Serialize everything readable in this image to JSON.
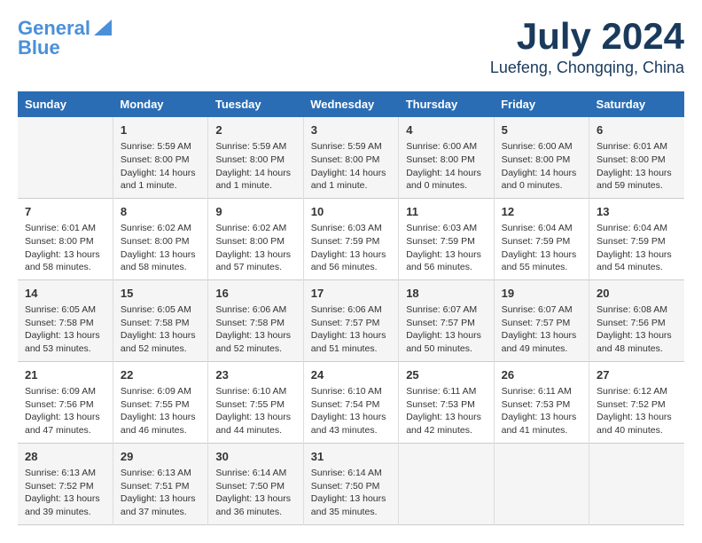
{
  "header": {
    "logo_line1": "General",
    "logo_line2": "Blue",
    "month_year": "July 2024",
    "location": "Luefeng, Chongqing, China"
  },
  "days_of_week": [
    "Sunday",
    "Monday",
    "Tuesday",
    "Wednesday",
    "Thursday",
    "Friday",
    "Saturday"
  ],
  "weeks": [
    [
      {
        "day": "",
        "content": ""
      },
      {
        "day": "1",
        "content": "Sunrise: 5:59 AM\nSunset: 8:00 PM\nDaylight: 14 hours\nand 1 minute."
      },
      {
        "day": "2",
        "content": "Sunrise: 5:59 AM\nSunset: 8:00 PM\nDaylight: 14 hours\nand 1 minute."
      },
      {
        "day": "3",
        "content": "Sunrise: 5:59 AM\nSunset: 8:00 PM\nDaylight: 14 hours\nand 1 minute."
      },
      {
        "day": "4",
        "content": "Sunrise: 6:00 AM\nSunset: 8:00 PM\nDaylight: 14 hours\nand 0 minutes."
      },
      {
        "day": "5",
        "content": "Sunrise: 6:00 AM\nSunset: 8:00 PM\nDaylight: 14 hours\nand 0 minutes."
      },
      {
        "day": "6",
        "content": "Sunrise: 6:01 AM\nSunset: 8:00 PM\nDaylight: 13 hours\nand 59 minutes."
      }
    ],
    [
      {
        "day": "7",
        "content": "Sunrise: 6:01 AM\nSunset: 8:00 PM\nDaylight: 13 hours\nand 58 minutes."
      },
      {
        "day": "8",
        "content": "Sunrise: 6:02 AM\nSunset: 8:00 PM\nDaylight: 13 hours\nand 58 minutes."
      },
      {
        "day": "9",
        "content": "Sunrise: 6:02 AM\nSunset: 8:00 PM\nDaylight: 13 hours\nand 57 minutes."
      },
      {
        "day": "10",
        "content": "Sunrise: 6:03 AM\nSunset: 7:59 PM\nDaylight: 13 hours\nand 56 minutes."
      },
      {
        "day": "11",
        "content": "Sunrise: 6:03 AM\nSunset: 7:59 PM\nDaylight: 13 hours\nand 56 minutes."
      },
      {
        "day": "12",
        "content": "Sunrise: 6:04 AM\nSunset: 7:59 PM\nDaylight: 13 hours\nand 55 minutes."
      },
      {
        "day": "13",
        "content": "Sunrise: 6:04 AM\nSunset: 7:59 PM\nDaylight: 13 hours\nand 54 minutes."
      }
    ],
    [
      {
        "day": "14",
        "content": "Sunrise: 6:05 AM\nSunset: 7:58 PM\nDaylight: 13 hours\nand 53 minutes."
      },
      {
        "day": "15",
        "content": "Sunrise: 6:05 AM\nSunset: 7:58 PM\nDaylight: 13 hours\nand 52 minutes."
      },
      {
        "day": "16",
        "content": "Sunrise: 6:06 AM\nSunset: 7:58 PM\nDaylight: 13 hours\nand 52 minutes."
      },
      {
        "day": "17",
        "content": "Sunrise: 6:06 AM\nSunset: 7:57 PM\nDaylight: 13 hours\nand 51 minutes."
      },
      {
        "day": "18",
        "content": "Sunrise: 6:07 AM\nSunset: 7:57 PM\nDaylight: 13 hours\nand 50 minutes."
      },
      {
        "day": "19",
        "content": "Sunrise: 6:07 AM\nSunset: 7:57 PM\nDaylight: 13 hours\nand 49 minutes."
      },
      {
        "day": "20",
        "content": "Sunrise: 6:08 AM\nSunset: 7:56 PM\nDaylight: 13 hours\nand 48 minutes."
      }
    ],
    [
      {
        "day": "21",
        "content": "Sunrise: 6:09 AM\nSunset: 7:56 PM\nDaylight: 13 hours\nand 47 minutes."
      },
      {
        "day": "22",
        "content": "Sunrise: 6:09 AM\nSunset: 7:55 PM\nDaylight: 13 hours\nand 46 minutes."
      },
      {
        "day": "23",
        "content": "Sunrise: 6:10 AM\nSunset: 7:55 PM\nDaylight: 13 hours\nand 44 minutes."
      },
      {
        "day": "24",
        "content": "Sunrise: 6:10 AM\nSunset: 7:54 PM\nDaylight: 13 hours\nand 43 minutes."
      },
      {
        "day": "25",
        "content": "Sunrise: 6:11 AM\nSunset: 7:53 PM\nDaylight: 13 hours\nand 42 minutes."
      },
      {
        "day": "26",
        "content": "Sunrise: 6:11 AM\nSunset: 7:53 PM\nDaylight: 13 hours\nand 41 minutes."
      },
      {
        "day": "27",
        "content": "Sunrise: 6:12 AM\nSunset: 7:52 PM\nDaylight: 13 hours\nand 40 minutes."
      }
    ],
    [
      {
        "day": "28",
        "content": "Sunrise: 6:13 AM\nSunset: 7:52 PM\nDaylight: 13 hours\nand 39 minutes."
      },
      {
        "day": "29",
        "content": "Sunrise: 6:13 AM\nSunset: 7:51 PM\nDaylight: 13 hours\nand 37 minutes."
      },
      {
        "day": "30",
        "content": "Sunrise: 6:14 AM\nSunset: 7:50 PM\nDaylight: 13 hours\nand 36 minutes."
      },
      {
        "day": "31",
        "content": "Sunrise: 6:14 AM\nSunset: 7:50 PM\nDaylight: 13 hours\nand 35 minutes."
      },
      {
        "day": "",
        "content": ""
      },
      {
        "day": "",
        "content": ""
      },
      {
        "day": "",
        "content": ""
      }
    ]
  ]
}
